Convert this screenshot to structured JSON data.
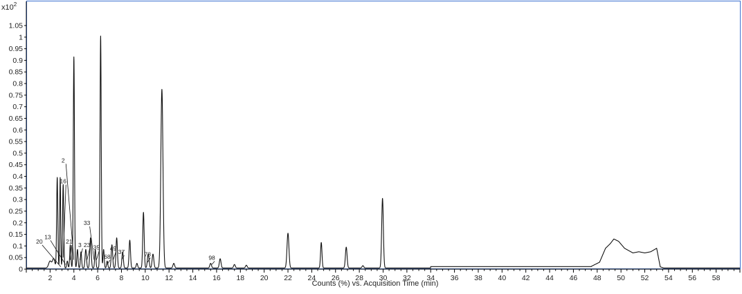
{
  "chart_data": {
    "type": "line",
    "title": "",
    "xlabel": "Counts (%) vs. Acquisition Time (min)",
    "ylabel": "",
    "y_scale_label": "x10",
    "y_scale_exponent": "2",
    "xlim": [
      0,
      60
    ],
    "ylim": [
      0,
      1.05
    ],
    "x_ticks": [
      2,
      4,
      6,
      8,
      10,
      12,
      14,
      16,
      18,
      20,
      22,
      24,
      26,
      28,
      30,
      32,
      34,
      36,
      38,
      40,
      42,
      44,
      46,
      48,
      50,
      52,
      54,
      56,
      58
    ],
    "y_ticks": [
      0,
      0.05,
      0.1,
      0.15,
      0.2,
      0.25,
      0.3,
      0.35,
      0.4,
      0.45,
      0.5,
      0.55,
      0.6,
      0.65,
      0.7,
      0.75,
      0.8,
      0.85,
      0.9,
      0.95,
      1,
      1.05
    ],
    "grid": false,
    "legend": "none",
    "baseline": 0.005,
    "peaks": [
      {
        "x": 2.0,
        "y": 0.03,
        "w": 0.12
      },
      {
        "x": 2.3,
        "y": 0.04,
        "w": 0.1
      },
      {
        "x": 2.6,
        "y": 0.39,
        "w": 0.05
      },
      {
        "x": 2.85,
        "y": 0.39,
        "w": 0.04
      },
      {
        "x": 3.1,
        "y": 0.36,
        "w": 0.05
      },
      {
        "x": 3.45,
        "y": 0.03,
        "w": 0.05
      },
      {
        "x": 3.7,
        "y": 0.1,
        "w": 0.05
      },
      {
        "x": 4.0,
        "y": 0.91,
        "w": 0.05
      },
      {
        "x": 4.3,
        "y": 0.08,
        "w": 0.05
      },
      {
        "x": 4.6,
        "y": 0.07,
        "w": 0.05
      },
      {
        "x": 5.0,
        "y": 0.08,
        "w": 0.06
      },
      {
        "x": 5.4,
        "y": 0.13,
        "w": 0.06
      },
      {
        "x": 5.8,
        "y": 0.08,
        "w": 0.05
      },
      {
        "x": 6.25,
        "y": 1.0,
        "w": 0.05
      },
      {
        "x": 6.5,
        "y": 0.08,
        "w": 0.05
      },
      {
        "x": 6.8,
        "y": 0.03,
        "w": 0.05
      },
      {
        "x": 7.2,
        "y": 0.1,
        "w": 0.06
      },
      {
        "x": 7.6,
        "y": 0.13,
        "w": 0.06
      },
      {
        "x": 8.1,
        "y": 0.07,
        "w": 0.06
      },
      {
        "x": 8.7,
        "y": 0.12,
        "w": 0.06
      },
      {
        "x": 9.3,
        "y": 0.02,
        "w": 0.06
      },
      {
        "x": 9.85,
        "y": 0.24,
        "w": 0.06
      },
      {
        "x": 10.25,
        "y": 0.06,
        "w": 0.07
      },
      {
        "x": 10.65,
        "y": 0.06,
        "w": 0.07
      },
      {
        "x": 11.4,
        "y": 0.77,
        "w": 0.09
      },
      {
        "x": 12.4,
        "y": 0.02,
        "w": 0.07
      },
      {
        "x": 15.5,
        "y": 0.02,
        "w": 0.07
      },
      {
        "x": 16.3,
        "y": 0.04,
        "w": 0.07
      },
      {
        "x": 17.5,
        "y": 0.015,
        "w": 0.07
      },
      {
        "x": 18.5,
        "y": 0.012,
        "w": 0.07
      },
      {
        "x": 22.0,
        "y": 0.15,
        "w": 0.08
      },
      {
        "x": 24.8,
        "y": 0.11,
        "w": 0.06
      },
      {
        "x": 26.9,
        "y": 0.09,
        "w": 0.07
      },
      {
        "x": 28.3,
        "y": 0.01,
        "w": 0.07
      },
      {
        "x": 29.95,
        "y": 0.3,
        "w": 0.07
      }
    ],
    "hump": [
      [
        47.5,
        0.012
      ],
      [
        48.2,
        0.03
      ],
      [
        48.7,
        0.09
      ],
      [
        49.1,
        0.11
      ],
      [
        49.4,
        0.13
      ],
      [
        49.8,
        0.12
      ],
      [
        50.3,
        0.09
      ],
      [
        51.0,
        0.07
      ],
      [
        51.5,
        0.075
      ],
      [
        52.0,
        0.07
      ],
      [
        52.5,
        0.075
      ],
      [
        53.0,
        0.09
      ],
      [
        53.3,
        0.01
      ],
      [
        53.6,
        0.005
      ]
    ],
    "peak_labels": [
      {
        "text": "2",
        "x": 3.1,
        "y": 0.46,
        "tip_x": 4.0,
        "tip_y": 0.04
      },
      {
        "text": "16",
        "x": 3.1,
        "y": 0.37,
        "tip_x": 3.1,
        "tip_y": 0.05
      },
      {
        "text": "13",
        "x": 1.8,
        "y": 0.13,
        "tip_x": 3.3,
        "tip_y": 0.02
      },
      {
        "text": "20",
        "x": 1.1,
        "y": 0.11,
        "tip_x": 2.9,
        "tip_y": 0.01
      },
      {
        "text": "21",
        "x": 3.6,
        "y": 0.11,
        "tip_x": 3.7,
        "tip_y": 0.04
      },
      {
        "text": "3",
        "x": 4.5,
        "y": 0.095,
        "tip_x": 4.5,
        "tip_y": 0.04
      },
      {
        "text": "23",
        "x": 5.1,
        "y": 0.095,
        "tip_x": 5.1,
        "tip_y": 0.04
      },
      {
        "text": "33",
        "x": 5.1,
        "y": 0.19,
        "tip_x": 5.7,
        "tip_y": 0.04
      },
      {
        "text": "35",
        "x": 5.9,
        "y": 0.085,
        "tip_x": 5.9,
        "tip_y": 0.04
      },
      {
        "text": "49",
        "x": 7.3,
        "y": 0.08,
        "tip_x": 7.3,
        "tip_y": 0.04
      },
      {
        "text": "37",
        "x": 8.0,
        "y": 0.065,
        "tip_x": 8.0,
        "tip_y": 0.04
      },
      {
        "text": "68",
        "x": 6.8,
        "y": 0.045,
        "tip_x": 6.8,
        "tip_y": 0.02
      },
      {
        "text": "78",
        "x": 10.2,
        "y": 0.055,
        "tip_x": 10.2,
        "tip_y": 0.03
      },
      {
        "text": "98",
        "x": 15.6,
        "y": 0.04,
        "tip_x": 15.6,
        "tip_y": 0.02
      }
    ]
  }
}
